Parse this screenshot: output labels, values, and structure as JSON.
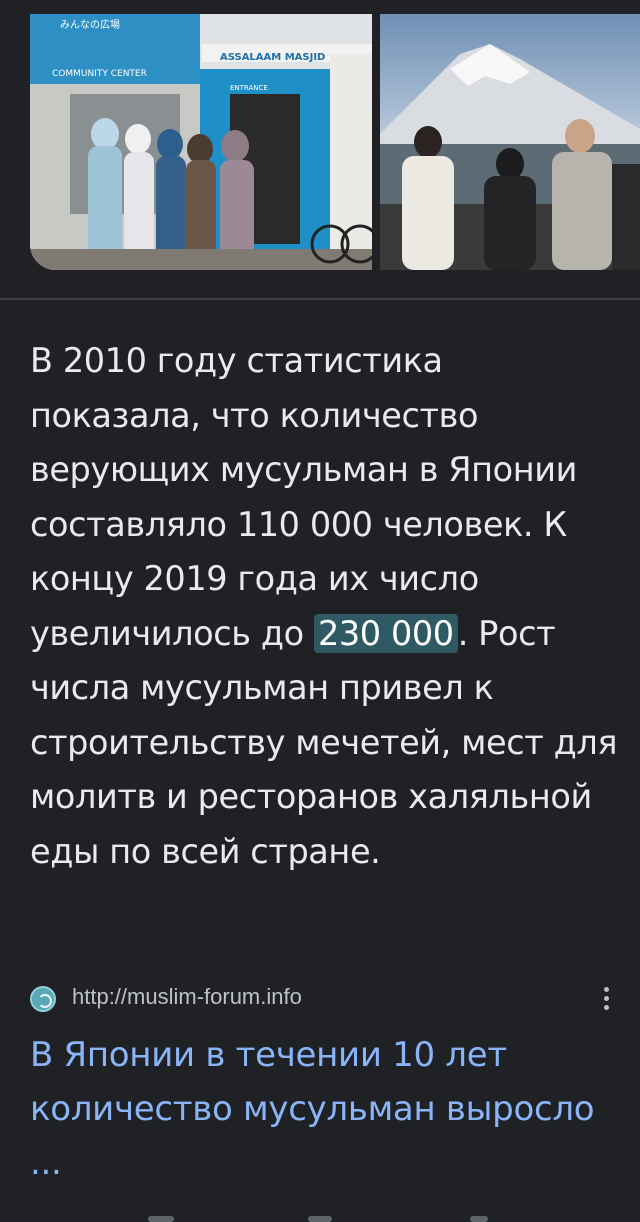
{
  "images": {
    "left_alt": "",
    "left_sign_lines": [
      "みんなの広場",
      "ASSALAAM MASJID",
      "COMMUNITY CENTER",
      "ENTRANCE"
    ],
    "right_alt": ""
  },
  "snippet": {
    "text_before": "В 2010 году статистика показала, что количество верующих мусульман в Японии составляло 110 000 человек. К концу 2019 года их число увеличилось до ",
    "highlight": "230 000",
    "text_after": ". Рост числа мусульман привел к строительству мечетей, мест для молитв и ресторанов халяльной еды по всей стране."
  },
  "source": {
    "url": "http://muslim-forum.info",
    "favicon": "site-favicon",
    "more": "more-vert-icon"
  },
  "result": {
    "title": "В Японии в течении 10 лет количество мусульман выросло ..."
  },
  "colors": {
    "background": "#202124",
    "text": "#e8eaed",
    "link": "#8ab4f8",
    "highlight": "#2f5a63"
  }
}
